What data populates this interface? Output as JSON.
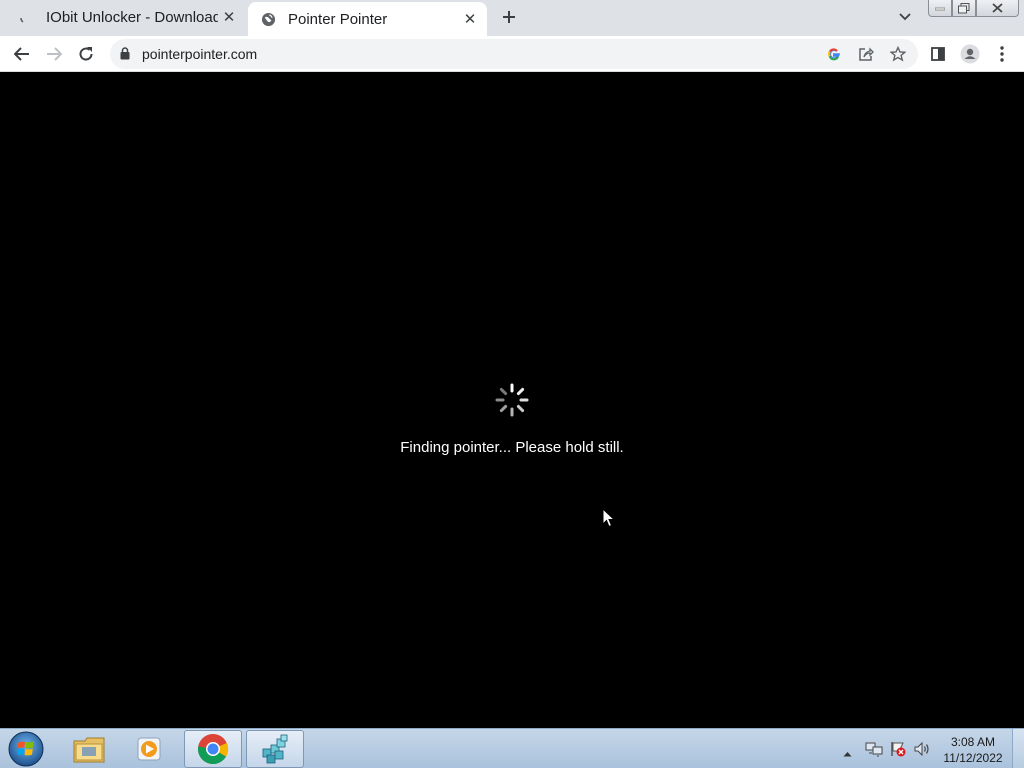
{
  "browser": {
    "tabs": [
      {
        "title": "IObit Unlocker - Download",
        "favicon": "loading-icon",
        "active": false
      },
      {
        "title": "Pointer Pointer",
        "favicon": "globe-icon",
        "active": true
      }
    ],
    "url": "pointerpointer.com",
    "toolbar_icons": [
      "back-icon",
      "forward-icon",
      "reload-icon",
      "lock-icon",
      "google-icon",
      "share-icon",
      "star-icon",
      "side-panel-icon",
      "profile-icon",
      "menu-icon"
    ]
  },
  "page": {
    "status": "Finding pointer... Please hold still."
  },
  "taskbar": {
    "apps": [
      "windows-start-icon",
      "file-explorer-icon",
      "media-player-icon",
      "chrome-icon",
      "registry-editor-icon"
    ],
    "clock": {
      "time": "3:08 AM",
      "date": "11/12/2022"
    }
  }
}
